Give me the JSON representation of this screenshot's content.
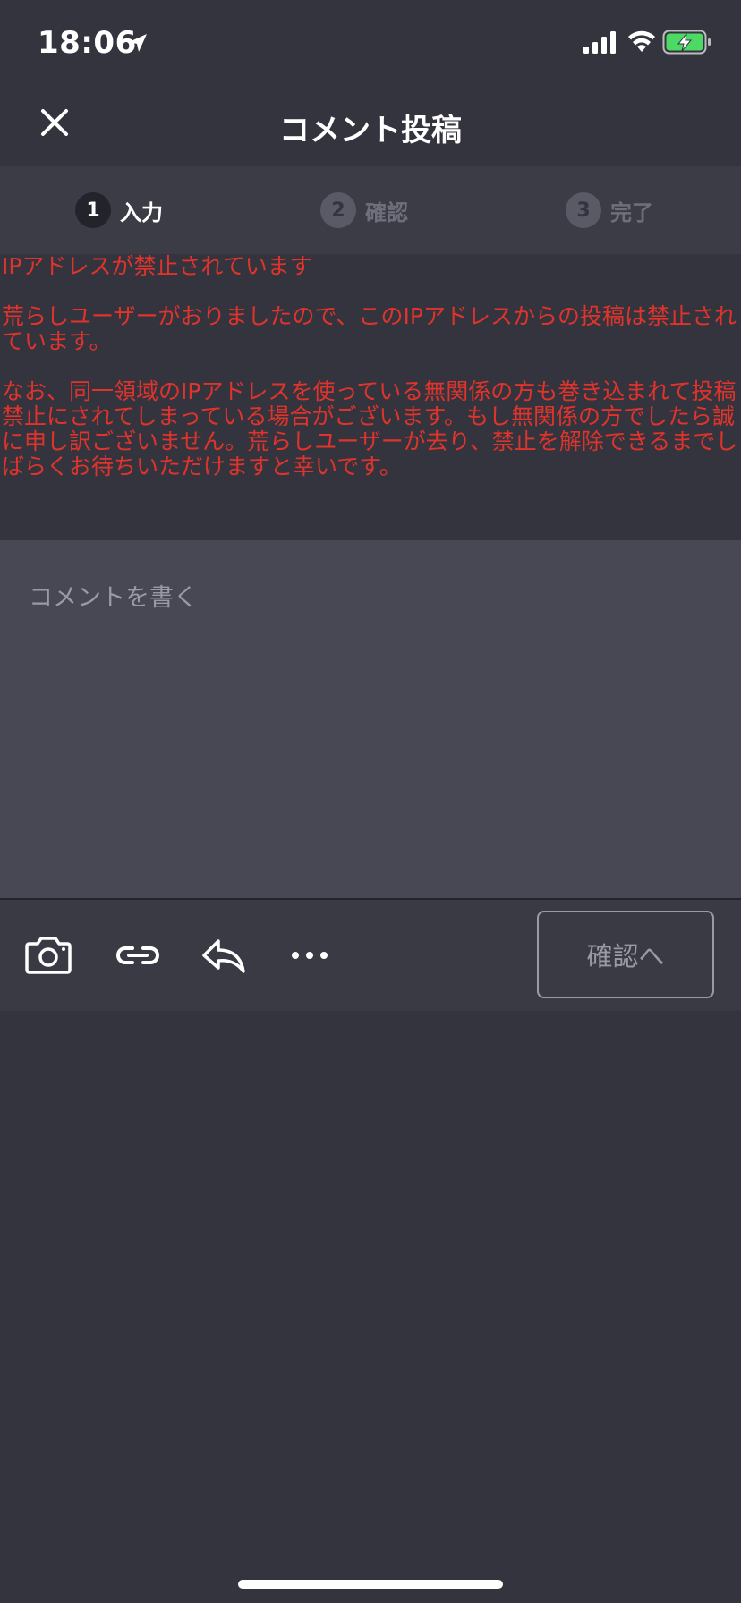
{
  "status_bar": {
    "time": "18:06",
    "icons": [
      "location-arrow-icon",
      "cellular-signal-icon",
      "wifi-icon",
      "battery-charging-icon"
    ],
    "battery_color": "#4cd964"
  },
  "nav": {
    "title": "コメント投稿",
    "close_icon": "close-icon"
  },
  "steps": [
    {
      "number": "1",
      "label": "入力",
      "state": "active"
    },
    {
      "number": "2",
      "label": "確認",
      "state": "inactive"
    },
    {
      "number": "3",
      "label": "完了",
      "state": "inactive"
    }
  ],
  "notice": {
    "color": "#e0332b",
    "heading": "IPアドレスが禁止されています",
    "paragraph1": "荒らしユーザーがおりましたので、このIPアドレスからの投稿は禁止されています。",
    "paragraph2": "なお、同一領域のIPアドレスを使っている無関係の方も巻き込まれて投稿禁止にされてしまっている場合がございます。もし無関係の方でしたら誠に申し訳ございません。荒らしユーザーが去り、禁止を解除できるまでしばらくお待ちいただけますと幸いです。"
  },
  "comment": {
    "placeholder": "コメントを書く",
    "value": ""
  },
  "toolbar": {
    "icons": [
      "camera-icon",
      "link-icon",
      "reply-icon",
      "more-icon"
    ],
    "confirm_label": "確認へ"
  }
}
